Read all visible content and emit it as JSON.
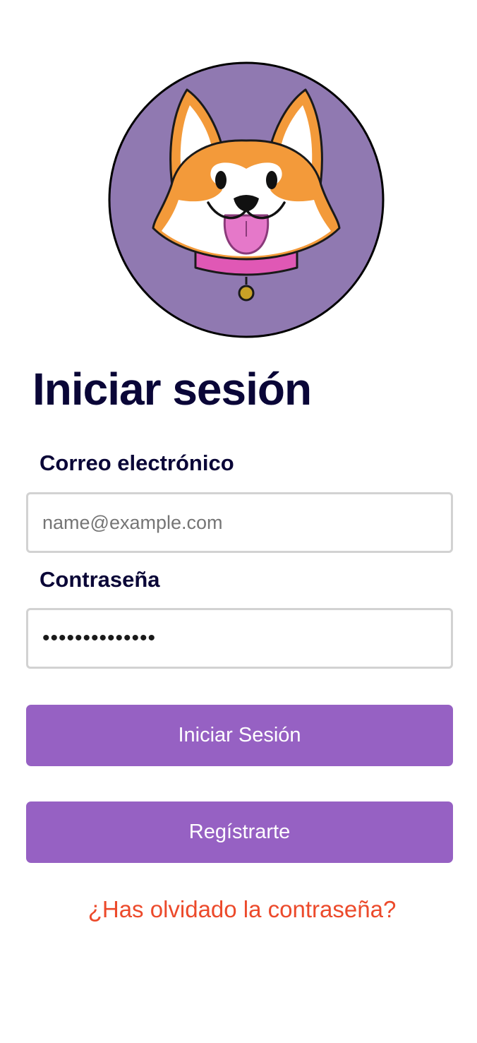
{
  "colors": {
    "logo_bg": "#9079b1",
    "title": "#0a0637",
    "button_bg": "#9661c3",
    "button_text": "#ffffff",
    "link": "#ec4a2b",
    "field_border": "#d2d2d2"
  },
  "logo": {
    "icon": "corgi-dog-icon"
  },
  "login": {
    "title": "Iniciar sesión",
    "email_label": "Correo electrónico",
    "email_placeholder": "name@example.com",
    "password_label": "Contraseña",
    "password_value": "••••••••••••••",
    "login_button": "Iniciar Sesión",
    "register_button": "Regístrarte",
    "forgot_password": "¿Has olvidado la contraseña?"
  }
}
